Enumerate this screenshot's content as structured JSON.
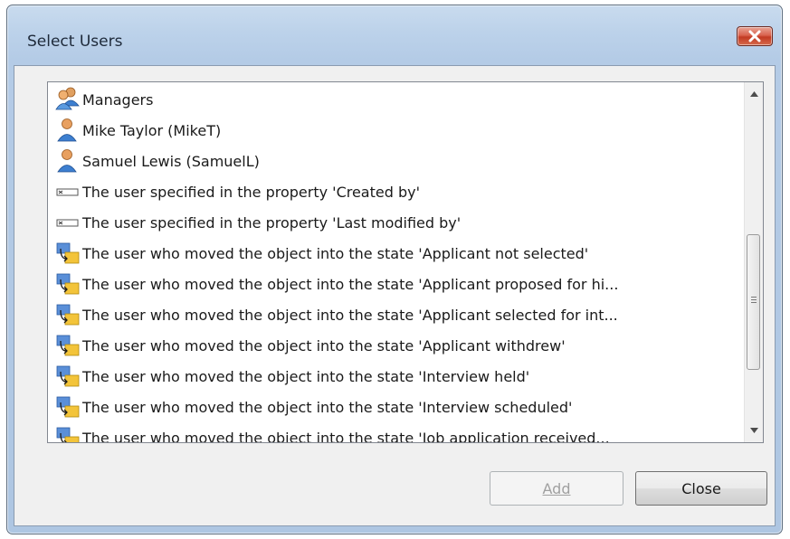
{
  "dialog": {
    "title": "Select Users",
    "close_icon": "close-x-icon"
  },
  "list": {
    "items": [
      {
        "icon": "user-group-icon",
        "label": "Managers"
      },
      {
        "icon": "user-icon",
        "label": "Mike Taylor (MikeT)"
      },
      {
        "icon": "user-icon",
        "label": "Samuel Lewis (SamuelL)"
      },
      {
        "icon": "property-icon",
        "label": "The user specified in the property 'Created by'"
      },
      {
        "icon": "property-icon",
        "label": "The user specified in the property 'Last modified by'"
      },
      {
        "icon": "state-transition-icon",
        "label": "The user who moved the object into the state 'Applicant not selected'"
      },
      {
        "icon": "state-transition-icon",
        "label": "The user who moved the object into the state 'Applicant proposed for hi..."
      },
      {
        "icon": "state-transition-icon",
        "label": "The user who moved the object into the state 'Applicant selected for int..."
      },
      {
        "icon": "state-transition-icon",
        "label": "The user who moved the object into the state 'Applicant withdrew'"
      },
      {
        "icon": "state-transition-icon",
        "label": "The user who moved the object into the state 'Interview held'"
      },
      {
        "icon": "state-transition-icon",
        "label": "The user who moved the object into the state 'Interview scheduled'"
      },
      {
        "icon": "state-transition-icon",
        "label": "The user who moved the object into the state 'Job application received..."
      }
    ]
  },
  "buttons": {
    "add_label": "Add",
    "add_enabled": false,
    "close_label": "Close"
  },
  "colors": {
    "frame": "#b4cbe6",
    "close_button": "#c23a23",
    "client_background": "#f0f0f0"
  }
}
